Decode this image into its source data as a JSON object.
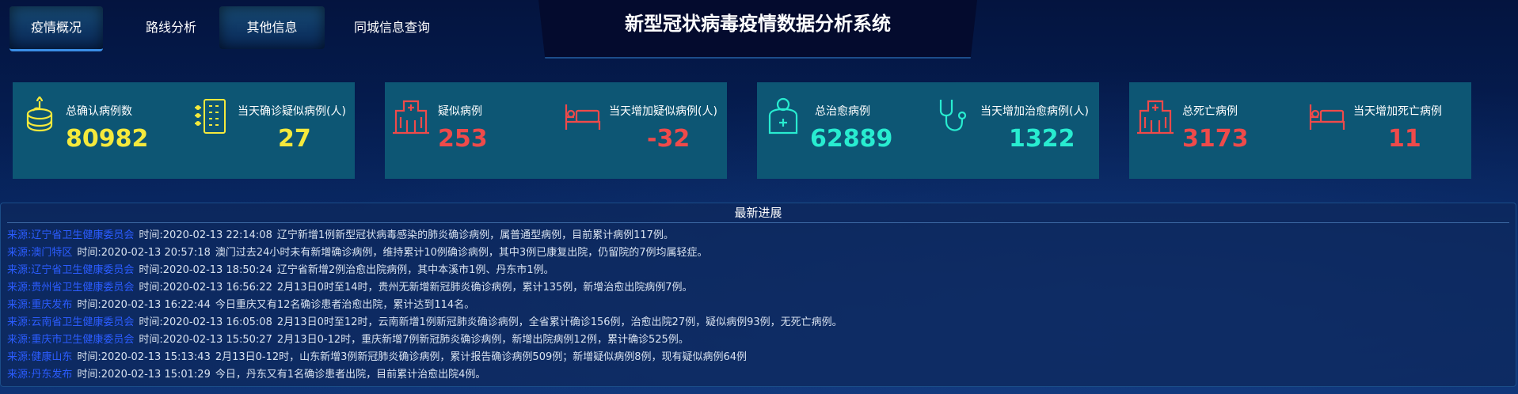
{
  "nav": {
    "tabs": [
      {
        "label": "疫情概况"
      },
      {
        "label": "路线分析"
      },
      {
        "label": "其他信息"
      },
      {
        "label": "同城信息查询"
      }
    ]
  },
  "header": {
    "title": "新型冠状病毒疫情数据分析系统"
  },
  "colors": {
    "yellow": "#f5e93c",
    "red": "#ef4a4a",
    "cyan": "#28ecd0",
    "card_bg": "#0d5674"
  },
  "stats": {
    "confirmed": {
      "label": "总确认病例数",
      "value": "80982",
      "icon": "cake-icon"
    },
    "new_confirmed": {
      "label": "当天确诊疑似病例(人)",
      "value": "27",
      "icon": "building-icon"
    },
    "suspected": {
      "label": "疑似病例",
      "value": "253",
      "icon": "hospital-icon"
    },
    "new_suspected": {
      "label": "当天增加疑似病例(人)",
      "value": "-32",
      "icon": "hospital-bed-icon"
    },
    "cured": {
      "label": "总治愈病例",
      "value": "62889",
      "icon": "medical-kit-icon"
    },
    "new_cured": {
      "label": "当天增加治愈病例(人)",
      "value": "1322",
      "icon": "stethoscope-icon"
    },
    "deaths": {
      "label": "总死亡病例",
      "value": "3173",
      "icon": "hospital-icon"
    },
    "new_deaths": {
      "label": "当天增加死亡病例",
      "value": "11",
      "icon": "hospital-bed-icon"
    }
  },
  "news": {
    "title": "最新进展",
    "items": [
      {
        "source": "来源:辽宁省卫生健康委员会",
        "time": "时间:2020-02-13 22:14:08",
        "text": "辽宁新增1例新型冠状病毒感染的肺炎确诊病例，属普通型病例，目前累计病例117例。"
      },
      {
        "source": "来源:澳门特区",
        "time": "时间:2020-02-13 20:57:18",
        "text": "澳门过去24小时未有新增确诊病例，维持累计10例确诊病例，其中3例已康复出院，仍留院的7例均属轻症。"
      },
      {
        "source": "来源:辽宁省卫生健康委员会",
        "time": "时间:2020-02-13 18:50:24",
        "text": "辽宁省新增2例治愈出院病例，其中本溪市1例、丹东市1例。"
      },
      {
        "source": "来源:贵州省卫生健康委员会",
        "time": "时间:2020-02-13 16:56:22",
        "text": "2月13日0时至14时，贵州无新增新冠肺炎确诊病例，累计135例，新增治愈出院病例7例。"
      },
      {
        "source": "来源:重庆发布",
        "time": "时间:2020-02-13 16:22:44",
        "text": "今日重庆又有12名确诊患者治愈出院，累计达到114名。"
      },
      {
        "source": "来源:云南省卫生健康委员会",
        "time": "时间:2020-02-13 16:05:08",
        "text": "2月13日0时至12时，云南新增1例新冠肺炎确诊病例，全省累计确诊156例，治愈出院27例，疑似病例93例，无死亡病例。"
      },
      {
        "source": "来源:重庆市卫生健康委员会",
        "time": "时间:2020-02-13 15:50:27",
        "text": "2月13日0-12时，重庆新增7例新冠肺炎确诊病例，新增出院病例12例，累计确诊525例。"
      },
      {
        "source": "来源:健康山东",
        "time": "时间:2020-02-13 15:13:43",
        "text": "2月13日0-12时，山东新增3例新冠肺炎确诊病例，累计报告确诊病例509例；新增疑似病例8例，现有疑似病例64例"
      },
      {
        "source": "来源:丹东发布",
        "time": "时间:2020-02-13 15:01:29",
        "text": "今日，丹东又有1名确诊患者出院，目前累计治愈出院4例。"
      }
    ]
  }
}
